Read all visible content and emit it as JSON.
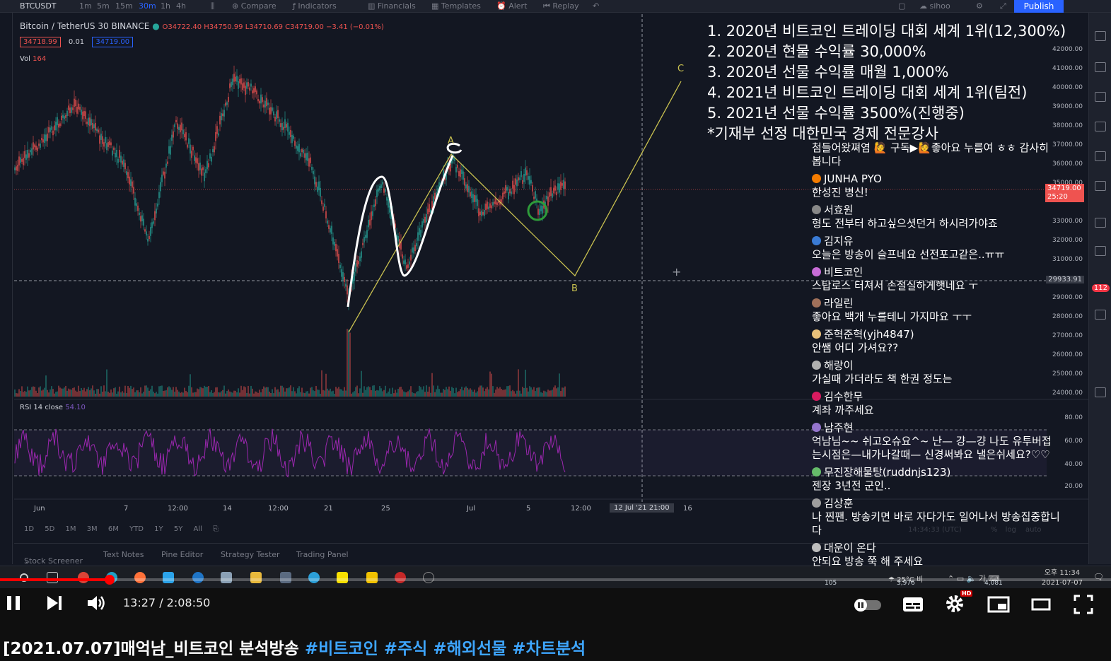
{
  "tradingview": {
    "symbol": "BTCUSDT",
    "intervals": [
      "1m",
      "5m",
      "15m",
      "30m",
      "1h",
      "4h"
    ],
    "active_interval": "30m",
    "toolbar_items": [
      "Compare",
      "Indicators",
      "Financials",
      "Templates",
      "Alert",
      "Replay"
    ],
    "user": "sihoo",
    "publish_label": "Publish",
    "legend_title": "Bitcoin / TetherUS",
    "legend_interval": "30",
    "legend_exchange": "BINANCE",
    "ohlc": "O34722.40 H34750.99 L34710.69 C34719.00 −3.41 (−0.01%)",
    "bid": "34718.99",
    "spread": "0.01",
    "ask": "34719.00",
    "vol_label": "Vol",
    "vol_value": "164",
    "rsi_label": "RSI 14 close",
    "rsi_value": "54.10",
    "price_axis": [
      "42000.00",
      "41000.00",
      "40000.00",
      "39000.00",
      "38000.00",
      "37000.00",
      "36000.00",
      "35000.00",
      "33000.00",
      "32000.00",
      "31000.00",
      "29000.00",
      "28000.00",
      "27000.00",
      "26000.00",
      "25000.00",
      "24000.00"
    ],
    "price_tag": "34719.00",
    "price_tag_time": "25:20",
    "crosshair_price": "29933.91",
    "rsi_axis": [
      "80.00",
      "60.00",
      "40.00",
      "20.00"
    ],
    "time_axis": [
      "Jun",
      "7",
      "12:00",
      "14",
      "12:00",
      "21",
      "25",
      "Jul",
      "5",
      "12:00",
      "16"
    ],
    "crosshair_date": "12 Jul '21",
    "crosshair_time": "21:00",
    "ranges": [
      "1D",
      "5D",
      "1M",
      "3M",
      "6M",
      "YTD",
      "1Y",
      "5Y",
      "All"
    ],
    "session_time": "14:34:33 (UTC)",
    "scale_options": [
      "%",
      "log",
      "auto"
    ],
    "bottom_tabs": [
      "Stock Screener",
      "Text Notes",
      "Pine Editor",
      "Strategy Tester",
      "Trading Panel"
    ],
    "notification_count": "112",
    "wave_labels": {
      "a": "A",
      "b": "B",
      "c": "C"
    }
  },
  "overlay": {
    "achievements": [
      "1. 2020년 비트코인 트레이딩 대회 세계 1위(12,300%)",
      "2. 2020년 현물 수익률 30,000%",
      "3. 2020년 선물 수익률 매월 1,000%",
      "4. 2021년 비트코인 트레이딩 대회 세계 1위(팀전)",
      "5. 2021년 선물 수익률 3500%(진행중)",
      "*기재부 선정 대한민국 경제 전문강사"
    ],
    "chat": [
      {
        "user": "",
        "text": "첨들어왔쪄염 🙋 구독▶🙋좋아요 누름여 ㅎㅎ 감사히 봅니다",
        "color": "#ffffff"
      },
      {
        "user": "JUNHA PYO",
        "text": "한성진 병신!",
        "color": "#f57c00"
      },
      {
        "user": "서효원",
        "text": "형도 전부터 하고싶으셧던거 하시려가야죠",
        "color": "#888888"
      },
      {
        "user": "김지유",
        "text": "오늘은 방송이 슬프네요 선전포고같은..ㅠㅠ",
        "color": "#3a7bd5"
      },
      {
        "user": "비트코인",
        "text": "스탑로스 터져서 손절실하게햇네요 ㅜ",
        "color": "#c86dd7"
      },
      {
        "user": "라일린",
        "text": "좋아요 백개 누를테니 가지마요 ㅜㅜ",
        "color": "#a0705a"
      },
      {
        "user": "준혁준혁(yjh4847)",
        "text": "안쌤 어디 가셔요??",
        "color": "#e8c07a"
      },
      {
        "user": "해랑이",
        "text": "가실때 가더라도 책 한권 정도는",
        "color": "#b0b0b0"
      },
      {
        "user": "김수한무",
        "text": "계좌 까주세요",
        "color": "#d81b60"
      },
      {
        "user": "남주현",
        "text": "억남님~~ 쉬고오슈요^~ 난— 걍—걍 나도 유투버접는시점은—내가나갈때— 신경써봐요 낼은쉬세요?♡♡",
        "color": "#9575cd"
      },
      {
        "user": "무진장해물탕(ruddnjs123)",
        "text": "젠장 3년전 군인..",
        "color": "#66bb6a"
      },
      {
        "user": "김상훈",
        "text": "나 찐팬. 방송키면 바로 자다가도 일어나서 방송집중합니다",
        "color": "#9e9e9e"
      },
      {
        "user": "대운이 온다",
        "text": "안되요 방송 쭉 해 주세요",
        "color": "#bdbdbd"
      }
    ],
    "chat_stats": [
      "105",
      "3,976",
      "4,081"
    ]
  },
  "taskbar": {
    "weather": "25°C 비",
    "clock_time": "오후 11:34",
    "clock_date": "2021-07-07"
  },
  "player": {
    "progress": 0.0985,
    "current_time": "13:27",
    "duration": "2:08:50",
    "time_display": "13:27 / 2:08:50",
    "settings_badge": "HD"
  },
  "video": {
    "title_prefix": "[2021.07.07]매억남_비트코인 분석방송",
    "hashtags": [
      "#비트코인",
      "#주식",
      "#해외선물",
      "#차트분석"
    ]
  },
  "colors": {
    "chart_bg": "#131722",
    "up": "#26a69a",
    "down": "#ef5350",
    "accent": "#2962ff",
    "wave": "#c8c050",
    "rsi": "#9c27b0",
    "youtube_red": "#ff0000",
    "hashtag": "#3ea6ff"
  }
}
